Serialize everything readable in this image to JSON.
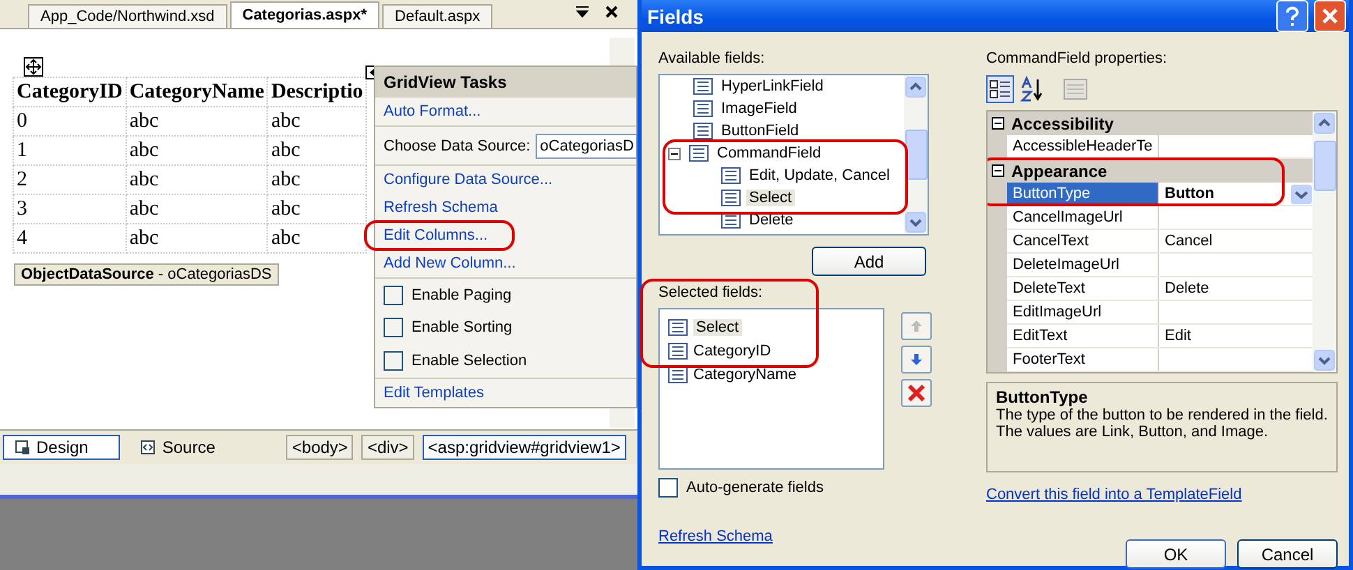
{
  "editor": {
    "tabs": [
      {
        "label": "App_Code/Northwind.xsd",
        "selected": false
      },
      {
        "label": "Categorias.aspx*",
        "selected": true
      },
      {
        "label": "Default.aspx",
        "selected": false
      }
    ],
    "grid": {
      "columns": [
        "CategoryID",
        "CategoryName",
        "Descriptio"
      ],
      "rows": [
        [
          "0",
          "abc",
          "abc"
        ],
        [
          "1",
          "abc",
          "abc"
        ],
        [
          "2",
          "abc",
          "abc"
        ],
        [
          "3",
          "abc",
          "abc"
        ],
        [
          "4",
          "abc",
          "abc"
        ]
      ]
    },
    "data_source": "**ObjectDataSource** - oCategoriasDS",
    "tasks": {
      "title": "GridView Tasks",
      "items": [
        {
          "kind": "link",
          "label": "Auto Format...",
          "highlighted": false
        },
        {
          "kind": "dropdown",
          "label": "Choose Data Source:",
          "value": "oCategoriasD"
        },
        {
          "kind": "link",
          "label": "Configure Data Source...",
          "highlighted": false
        },
        {
          "kind": "link",
          "label": "Refresh Schema",
          "highlighted": false
        },
        {
          "kind": "link",
          "label": "Edit Columns...",
          "highlighted": true
        },
        {
          "kind": "link",
          "label": "Add New Column...",
          "highlighted": false
        },
        {
          "kind": "checkbox",
          "label": "Enable Paging",
          "checked": false
        },
        {
          "kind": "checkbox",
          "label": "Enable Sorting",
          "checked": false
        },
        {
          "kind": "checkbox",
          "label": "Enable Selection",
          "checked": false
        },
        {
          "kind": "link",
          "label": "Edit Templates",
          "highlighted": false
        }
      ]
    },
    "view_tabs": [
      {
        "label": "Design",
        "selected": true
      },
      {
        "label": "Source",
        "selected": false
      }
    ],
    "breadcrumbs": [
      {
        "label": "<body>",
        "selected": false
      },
      {
        "label": "<div>",
        "selected": false
      },
      {
        "label": "<asp:gridview#gridview1>",
        "selected": true
      }
    ]
  },
  "dialog": {
    "title": "Fields",
    "available_label": "Available fields:",
    "available": [
      {
        "label": "HyperLinkField",
        "selected": false
      },
      {
        "label": "ImageField",
        "selected": false
      },
      {
        "label": "ButtonField",
        "selected": false
      },
      {
        "label": "CommandField",
        "selected": false,
        "expanded": true,
        "highlighted": true,
        "children": [
          {
            "label": "Edit, Update, Cancel",
            "selected": false
          },
          {
            "label": "Select",
            "selected": true
          },
          {
            "label": "Delete",
            "selected": false
          }
        ]
      }
    ],
    "add_button": "Add",
    "selected_label": "Selected fields:",
    "selected_highlighted": true,
    "selected": [
      {
        "label": "Select",
        "selected": true
      },
      {
        "label": "CategoryID",
        "selected": false
      },
      {
        "label": "CategoryName",
        "selected": false
      }
    ],
    "auto_generate": {
      "label": "Auto-generate fields",
      "checked": false
    },
    "refresh_link": "Refresh Schema",
    "properties_label": "CommandField properties:",
    "categories": [
      {
        "name": "Accessibility",
        "expanded": true,
        "highlighted": false,
        "rows": [
          {
            "name": "AccessibleHeaderTe",
            "selected": false,
            "modified": false
          }
        ]
      },
      {
        "name": "Appearance",
        "expanded": true,
        "highlighted": true,
        "rows": [
          {
            "name": "ButtonType",
            "value": "Button",
            "selected": true,
            "modified": true
          },
          {
            "name": "CancelImageUrl",
            "selected": false,
            "modified": false
          },
          {
            "name": "CancelText",
            "value": "Cancel",
            "selected": false,
            "modified": false
          },
          {
            "name": "DeleteImageUrl",
            "selected": false,
            "modified": false
          },
          {
            "name": "DeleteText",
            "value": "Delete",
            "selected": false,
            "modified": false
          },
          {
            "name": "EditImageUrl",
            "selected": false,
            "modified": false
          },
          {
            "name": "EditText",
            "value": "Edit",
            "selected": false,
            "modified": false
          },
          {
            "name": "FooterText",
            "selected": false,
            "modified": false
          }
        ]
      }
    ],
    "description": {
      "title": "ButtonType",
      "text": "The type of the button to be rendered in the field.  The values are Link, Button, and Image."
    },
    "convert_link": "Convert this field into a TemplateField",
    "buttons": [
      "OK",
      "Cancel"
    ]
  }
}
